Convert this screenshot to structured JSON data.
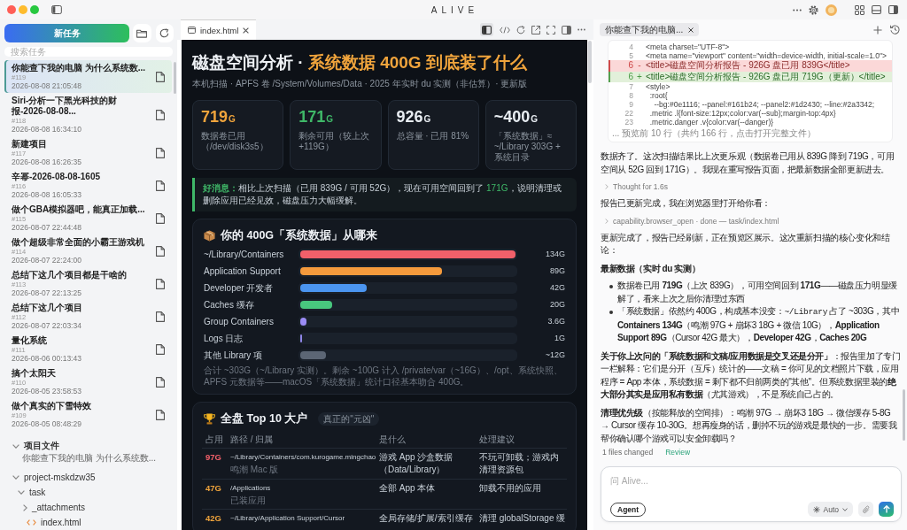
{
  "window": {
    "title": "ALIVE"
  },
  "sidebar": {
    "new_task": "新任务",
    "search": {
      "placeholder": "搜索任务"
    },
    "tasks": [
      {
        "title": "你能查下我的电脑 为什么系统数...",
        "number": "#119",
        "time": "2026-08-08 21:05:48",
        "selected": true
      },
      {
        "title": "Siri-分析一下黑光科技的财报-2026-08-08...",
        "number": "#118",
        "time": "2026-08-08 16:34:10",
        "selected": false
      },
      {
        "title": "新建项目",
        "number": "#117",
        "time": "2026-08-08 16:26:35",
        "selected": false
      },
      {
        "title": "辛幂-2026-08-08-1605",
        "number": "#116",
        "time": "2026-08-08 16:05:33",
        "selected": false
      },
      {
        "title": "做个GBA模拟器吧，能真正加载...",
        "number": "#115",
        "time": "2026-08-07 22:44:48",
        "selected": false
      },
      {
        "title": "做个超级非常全面的小霸王游戏机",
        "number": "#114",
        "time": "2026-08-07 22:24:00",
        "selected": false
      },
      {
        "title": "总结下这几个项目都是干啥的",
        "number": "#113",
        "time": "2026-08-07 22:13:25",
        "selected": false
      },
      {
        "title": "总结下这几个项目",
        "number": "#112",
        "time": "2026-08-07 22:03:34",
        "selected": false
      },
      {
        "title": "量化系统",
        "number": "#111",
        "time": "2026-08-06 00:13:43",
        "selected": false
      },
      {
        "title": "搞个太阳天",
        "number": "#110",
        "time": "2026-08-05 23:58:53",
        "selected": false
      },
      {
        "title": "做个真实的下雪特效",
        "number": "#109",
        "time": "2026-08-05 08:48:29",
        "selected": false
      }
    ],
    "project_files": {
      "title": "项目文件",
      "subtitle": "你能查下我的电脑 为什么系统数...",
      "expanded": true,
      "tree": [
        {
          "name": "project-mskdzw35",
          "kind": "folder",
          "expanded": true,
          "children": [
            {
              "name": "task",
              "kind": "folder",
              "expanded": true,
              "children": [
                {
                  "name": "_attachments",
                  "kind": "folder",
                  "expanded": false
                },
                {
                  "name": "index.html",
                  "kind": "file"
                }
              ]
            }
          ]
        }
      ]
    }
  },
  "preview": {
    "tabs": [
      {
        "label": "index.html",
        "selected": true
      }
    ],
    "split_view": {
      "on": true
    },
    "page": {
      "title": [
        {
          "text": "磁盘空间分析 · ",
          "kind": "plain"
        },
        {
          "text": "系统数据 400G 到底装了什么",
          "kind": "accent"
        }
      ],
      "subtitle": "本机扫描 · APFS 卷 /System/Volumes/Data · 2025 年实时 du 实测（非估算）· 更新版",
      "metrics": [
        {
          "value": "719",
          "unit": "G",
          "label": "数据卷已用（/dev/disk3s5）",
          "color": "#f0a43c"
        },
        {
          "value": "171",
          "unit": "G",
          "label": "剩余可用（较上次 +119G）",
          "color": "#3fb868"
        },
        {
          "value": "926",
          "unit": "G",
          "label": "总容量 · 已用 81%",
          "color": "#e8edf2"
        },
        {
          "value": "~400",
          "unit": "G",
          "label": "「系统数据」≈ ~/Library 303G + 系统目录",
          "color": "#e8edf2"
        }
      ],
      "notice": [
        {
          "text": "好消息：",
          "kind": "label"
        },
        {
          "text": "相比上次扫描（已用 839G / 可用 52G），现在可用空间回到了 ",
          "kind": "plain"
        },
        {
          "text": "171G",
          "kind": "good"
        },
        {
          "text": "，说明清理或删除应用已经见效，磁盘压力大幅缓解。",
          "kind": "plain"
        }
      ],
      "sources": {
        "title": "你的 400G「系统数据」从哪来",
        "rows": [
          {
            "label": "~/Library/Containers",
            "level": 1.0,
            "reading": "134G",
            "color": "#f2606a"
          },
          {
            "label": "Application Support",
            "level": 0.66,
            "reading": "89G",
            "color": "#f59a3c"
          },
          {
            "label": "Developer 开发者",
            "level": 0.31,
            "reading": "42G",
            "color": "#4b95f0"
          },
          {
            "label": "Caches 缓存",
            "level": 0.15,
            "reading": "20G",
            "color": "#48c77e"
          },
          {
            "label": "Group Containers",
            "level": 0.027,
            "reading": "3.6G",
            "color": "#9b8cf5"
          },
          {
            "label": "Logs 日志",
            "level": 0.008,
            "reading": "1G",
            "color": "#8f86e8"
          },
          {
            "label": "其他 Library 项",
            "level": 0.12,
            "reading": "~12G",
            "color": "#5c6675"
          }
        ],
        "note": "合计 ~303G（~/Library 实测）。剩余 ~100G 计入 /private/var（~16G）、/opt、系统快照、APFS 元数据等——macOS「系统数据」统计口径基本吻合 400G。"
      },
      "top10": {
        "title": "全盘 Top 10 大户",
        "badge": "真正的\"元凶\"",
        "columns": [
          "占用",
          "路径 / 归属",
          "是什么",
          "处理建议"
        ],
        "rows": [
          {
            "size": "97G",
            "color": "#f2606a",
            "path": "~/Library/Containers/com.kurogame.mingchao",
            "owner": "鸣潮 Mac 版",
            "what": "游戏 App 沙盒数据（Data/Library）",
            "advice": "不玩可卸载；游戏内清理资源包"
          },
          {
            "size": "47G",
            "color": "#f0a43c",
            "path": "/Applications",
            "owner": "已装应用",
            "what": "全部 App 本体",
            "advice": "卸载不用的应用"
          },
          {
            "size": "42G",
            "color": "#f0a43c",
            "path": "~/Library/Application Support/Cursor",
            "what": "全局存储/扩展/索引缓存",
            "advice": "清理 globalStorage 缓"
          }
        ]
      }
    }
  },
  "chat": {
    "tabs": [
      {
        "label": "你能查下我的电脑...",
        "selected": true
      }
    ],
    "diff": {
      "lines": [
        {
          "number": "4",
          "kind": "context",
          "code": "<meta charset=\"UTF-8\">"
        },
        {
          "number": "5",
          "kind": "context",
          "code": "<meta name=\"viewport\" content=\"width=device-width, initial-scale=1.0\">"
        },
        {
          "number": "6",
          "sign": "-",
          "kind": "removed",
          "code": "<title>磁盘空间分析报告 - 926G 盘已用 839G</title>"
        },
        {
          "number": "6",
          "sign": "+",
          "kind": "added",
          "code": "<title>磁盘空间分析报告 - 926G 盘已用 719G（更新）</title>"
        },
        {
          "number": "7",
          "kind": "context",
          "code": "<style>"
        },
        {
          "number": "8",
          "kind": "context",
          "code": "  :root{"
        },
        {
          "number": "9",
          "kind": "context",
          "code": "    --bg:#0e1116; --panel:#161b24; --panel2:#1d2430; --line:#2a3342;"
        },
        {
          "number": "22",
          "kind": "context",
          "code": "  .metric .l{font-size:12px;color:var(--sub);margin-top:4px}"
        },
        {
          "number": "23",
          "kind": "context",
          "code": "  .metric.danger .v{color:var(--danger)}"
        }
      ],
      "footer": "... 预览前 10 行（共约 166 行，点击打开完整文件）"
    },
    "messages": [
      {
        "kind": "paragraph",
        "text": "数据齐了。这次扫描结果比上次更乐观（数据卷已用从 839G 降到 719G，可用空间从 52G 回到 171G）。我现在重写报告页面，把最新数据全部更新进去。"
      },
      {
        "kind": "step",
        "text": "Thought for 1.6s"
      },
      {
        "kind": "paragraph",
        "text": "报告已更新完成，我在浏览器里打开给你看："
      },
      {
        "kind": "step",
        "text": "capability.browser_open · done — task/index.html"
      },
      {
        "kind": "paragraph",
        "text": "更新完成了，报告已经刷新，正在预览区展示。这次重新扫描的核心变化和结论："
      },
      {
        "kind": "heading",
        "text": "最新数据（实时 du 实测）"
      },
      {
        "kind": "bullets",
        "items": [
          [
            {
              "text": "数据卷已用 **719G**（上次 839G），可用空间回到 **171G**——磁盘压力明显缓解了，看来上次之后你清理过东西",
              "kind": "plain"
            }
          ],
          [
            {
              "text": "「系统数据」依然约 400G，构成基本没变：",
              "kind": "plain"
            },
            {
              "text": "~/Library",
              "kind": "code"
            },
            {
              "text": " 占了 ~303G，其中 **Containers 134G**（鸣潮 97G + 崩坏3 18G + 微信 10G），**Application Support 89G**（Cursor 42G 最大），**Developer 42G**，**Caches 20G**",
              "kind": "plain"
            }
          ]
        ]
      },
      {
        "kind": "paragraph",
        "text": "**关于你上次问的「系统数据和文稿/应用数据是交叉还是分开」**：报告里加了专门一栏解释：它们是分开（互斥）统计的——文稿 = 你可见的文档照片下载，应用程序 = App 本体，系统数据 = 剩下都不归前两类的\"其他\"。但系统数据里装的**绝大部分其实是应用私有数据**（尤其游戏），不是系统自己占的。"
      },
      {
        "kind": "paragraph",
        "text": "**清理优先级**（按能释放的空间排）：鸣潮 97G → 崩坏3 18G → 微信缓存 5-8G → Cursor 缓存 10-30G。想再瘦身的话，删掉不玩的游戏是最快的一步。需要我帮你确认哪个游戏可以安全卸载吗？"
      }
    ],
    "changes": {
      "summary": "1 files changed",
      "link": "Review"
    },
    "composer": {
      "placeholder": "问 Alive...",
      "mode": "Agent",
      "model": "Auto"
    }
  }
}
